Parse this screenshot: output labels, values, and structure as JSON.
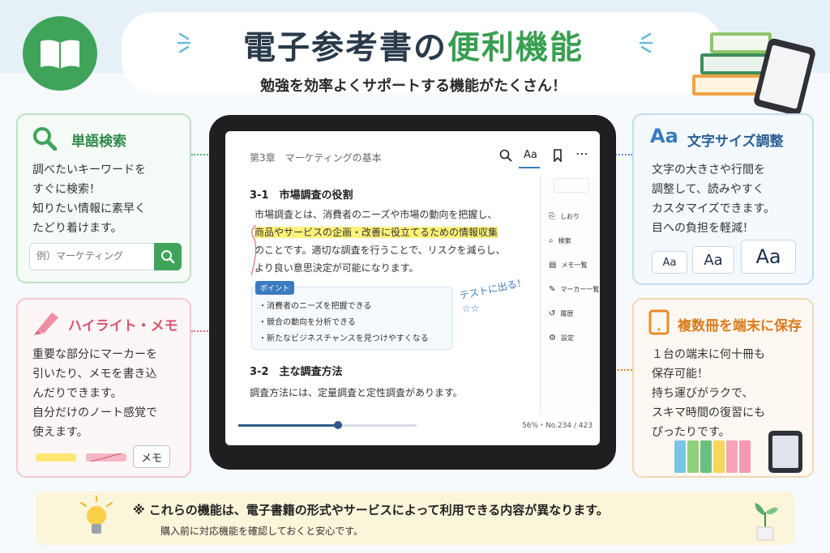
{
  "header": {
    "title_part1": "電子参考書の",
    "title_part2": "便利機能",
    "subtitle": "勉強を効率よくサポートする機能がたくさん！"
  },
  "colors": {
    "green": "#3fa45a",
    "red": "#e06b80",
    "blue": "#3a7bbf",
    "orange": "#e98a2a",
    "title": "#2a3a4a"
  },
  "search_card": {
    "icon": "magnifier-icon",
    "title": "単語検索",
    "body": [
      "調べたいキーワードを",
      "すぐに検索！",
      "知りたい情報に素早く",
      "たどり着けます。"
    ],
    "placeholder": "例）マーケティング"
  },
  "highlight_card": {
    "icon": "marker-icon",
    "title": "ハイライト・メモ",
    "body": [
      "重要な部分にマーカーを",
      "引いたり、メモを書き込",
      "んだりできます。",
      "自分だけのノート感覚で",
      "使えます。"
    ],
    "memo_label": "メモ"
  },
  "font_card": {
    "icon": "Aa",
    "title": "文字サイズ調整",
    "body": [
      "文字の大きさや行間を",
      "調整して、読みやすく",
      "カスタマイズできます。",
      "目への負担を軽減！"
    ],
    "samples": [
      "Aa",
      "Aa",
      "Aa"
    ]
  },
  "storage_card": {
    "icon": "tablet-icon",
    "title": "複数冊を端末に保存",
    "body": [
      "１台の端末に何十冊も",
      "保存可能！",
      "持ち運びがラクで、",
      "スキマ時間の復習にも",
      "ぴったりです。"
    ]
  },
  "reader": {
    "chapter": "第3章　マーケティングの基本",
    "toolbar": [
      "search-icon",
      "Aa",
      "bookmark-icon",
      "more-icon"
    ],
    "section1": "3-1　市場調査の役割",
    "para1_line1": "市場調査とは、消費者のニーズや市場の動向を把握し、",
    "para1_highlight": "商品やサービスの企画・改善に役立てるための情報収集",
    "para1_line3": "のことです。適切な調査を行うことで、リスクを減らし、",
    "para1_line4": "より良い意思決定が可能になります。",
    "point_tag": "ポイント",
    "points": [
      "・消費者のニーズを把握できる",
      "・競合の動向を分析できる",
      "・新たなビジネスチャンスを見つけやすくなる"
    ],
    "handwritten": "テストに出る！",
    "section2": "3-2　主な調査方法",
    "para2": "調査方法には、定量調査と定性調査があります。",
    "menu": [
      "しおり",
      "検索",
      "メモ一覧",
      "マーカー一覧",
      "履歴",
      "設定"
    ],
    "progress_percent": 56,
    "progress_text": "56%・No.234 / 423"
  },
  "footer": {
    "main": "※ これらの機能は、電子書籍の形式やサービスによって利用できる内容が異なります。",
    "sub": "購入前に対応機能を確認しておくと安心です。"
  }
}
